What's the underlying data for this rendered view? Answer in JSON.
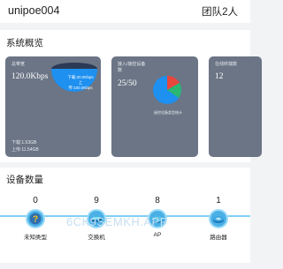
{
  "header": {
    "user_name": "unipoe004",
    "team_label": "团队2人"
  },
  "overview": {
    "title": "系统概览",
    "traffic_card": {
      "label": "总带宽",
      "value": "120.0Kbps",
      "bubble_lines": [
        "下载:20.0Kbps",
        "上",
        "传:100.0Kbps"
      ],
      "download_line": "下载:1.53GB",
      "upload_line": "上传:11.54GB",
      "accent": "#1e90f0"
    },
    "access_card": {
      "label": "接入/接控设备",
      "label2": "数",
      "value": "25/50",
      "chart_label": "接控设备类型统计",
      "chart_colors": [
        "#1e90f0",
        "#e8473c",
        "#2bb673"
      ]
    },
    "online_card": {
      "label": "在线终端数",
      "value": "12"
    }
  },
  "devices": {
    "title": "设备数量",
    "items": [
      {
        "count": "0",
        "label": "未知类型",
        "icon": "question-icon"
      },
      {
        "count": "9",
        "label": "交换机",
        "icon": "switch-icon"
      },
      {
        "count": "8",
        "label": "AP",
        "icon": "ap-icon"
      },
      {
        "count": "1",
        "label": "路由器",
        "icon": "router-icon"
      }
    ],
    "line_color": "#7fd0f5",
    "node_color": "#4ab0e6"
  },
  "watermark": "6CK9SEMKH.APP"
}
